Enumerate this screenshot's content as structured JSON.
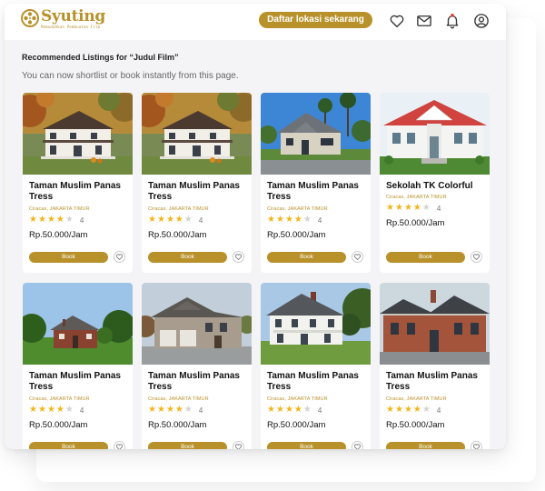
{
  "header": {
    "logo_text": "Syuting",
    "logo_tagline": "Memudahkan Pembuatan Film",
    "cta_label": "Daftar lokasi sekarang",
    "icons": [
      "heart-icon",
      "mail-icon",
      "bell-icon",
      "user-icon"
    ]
  },
  "section": {
    "title": "Recommended Listings for “Judul Film”",
    "subtitle": "You can now shortlist or book instantly from this page."
  },
  "colors": {
    "accent": "#b8912a",
    "star": "#f3b51c",
    "notif_dot": "#e53935"
  },
  "listings": [
    {
      "title": "Taman Muslim Panas Tress",
      "location": "Ciracas, JAKARTA TIMUR",
      "rating": 4,
      "rating_label": "4",
      "price": "Rp.50.000/Jam",
      "book_label": "Book",
      "image": "white-colonial-house-autumn"
    },
    {
      "title": "Taman Muslim Panas Tress",
      "location": "Ciracas, JAKARTA TIMUR",
      "rating": 4,
      "rating_label": "4",
      "price": "Rp.50.000/Jam",
      "book_label": "Book",
      "image": "white-colonial-house-autumn"
    },
    {
      "title": "Taman Muslim Panas Tress",
      "location": "Ciracas, JAKARTA TIMUR",
      "rating": 4,
      "rating_label": "4",
      "price": "Rp.50.000/Jam",
      "book_label": "Book",
      "image": "gray-house-palm-trees"
    },
    {
      "title": "Sekolah TK Colorful",
      "location": "Ciracas, JAKARTA TIMUR",
      "rating": 4,
      "rating_label": "4",
      "price": "Rp.50.000/Jam",
      "book_label": "Book",
      "image": "white-house-red-roof"
    },
    {
      "title": "Taman Muslim Panas Tress",
      "location": "Ciracas, JAKARTA TIMUR",
      "rating": 4,
      "rating_label": "4",
      "price": "Rp.50.000/Jam",
      "book_label": "Book",
      "image": "brick-house-lawn"
    },
    {
      "title": "Taman Muslim Panas Tress",
      "location": "Ciracas, JAKARTA TIMUR",
      "rating": 4,
      "rating_label": "4",
      "price": "Rp.50.000/Jam",
      "book_label": "Book",
      "image": "suburban-house-garage"
    },
    {
      "title": "Taman Muslim Panas Tress",
      "location": "Ciracas, JAKARTA TIMUR",
      "rating": 4,
      "rating_label": "4",
      "price": "Rp.50.000/Jam",
      "book_label": "Book",
      "image": "white-farmhouse-porch"
    },
    {
      "title": "Taman Muslim Panas Tress",
      "location": "Ciracas, JAKARTA TIMUR",
      "rating": 4,
      "rating_label": "4",
      "price": "Rp.50.000/Jam",
      "book_label": "Book",
      "image": "red-brick-house-gray-roof"
    }
  ]
}
